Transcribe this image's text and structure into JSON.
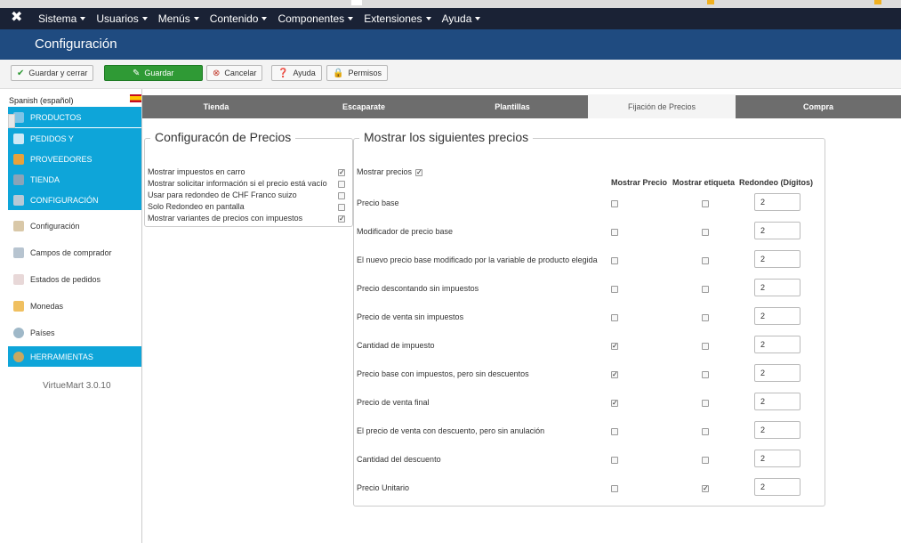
{
  "nav": {
    "items": [
      "Sistema",
      "Usuarios",
      "Menús",
      "Contenido",
      "Componentes",
      "Extensiones",
      "Ayuda"
    ]
  },
  "header": {
    "title": "Configuración"
  },
  "toolbar": {
    "save_close": "Guardar y cerrar",
    "save": "Guardar",
    "cancel": "Cancelar",
    "help": "Ayuda",
    "permissions": "Permisos"
  },
  "sidebar": {
    "language": "Spanish (español)",
    "items": [
      {
        "label": "PRODUCTOS",
        "icon": "box-icon",
        "style": "blue"
      },
      {
        "label": "PEDIDOS Y",
        "icon": "copy-icon",
        "style": "blue"
      },
      {
        "label": "PROVEEDORES",
        "icon": "wrench-icon",
        "style": "blue"
      },
      {
        "label": "TIENDA",
        "icon": "store-icon",
        "style": "blue"
      },
      {
        "label": "CONFIGURACIÓN",
        "icon": "tools-icon",
        "style": "blue"
      },
      {
        "label": "Configuración",
        "icon": "tools-icon",
        "style": "white"
      },
      {
        "label": "Campos de comprador",
        "icon": "form-icon",
        "style": "white"
      },
      {
        "label": "Estados de pedidos",
        "icon": "document-icon",
        "style": "white"
      },
      {
        "label": "Monedas",
        "icon": "coins-icon",
        "style": "white"
      },
      {
        "label": "Países",
        "icon": "globe-icon",
        "style": "white"
      },
      {
        "label": "HERRAMIENTAS",
        "icon": "gear-icon",
        "style": "blue"
      }
    ],
    "version": "VirtueMart 3.0.10"
  },
  "tabs": [
    "Tienda",
    "Escaparate",
    "Plantillas",
    "Fijación de Precios",
    "Compra"
  ],
  "active_tab": "Fijación de Precios",
  "left_panel": {
    "legend": "Configuracón de Precios",
    "rows": [
      {
        "label": "Mostrar impuestos en carro",
        "checked": true
      },
      {
        "label": "Mostrar solicitar información si el precio está vacío",
        "checked": false
      },
      {
        "label": "Usar para redondeo de CHF Franco suizo",
        "checked": false
      },
      {
        "label": "Solo Redondeo en pantalla",
        "checked": false
      },
      {
        "label": "Mostrar variantes de precios con impuestos",
        "checked": true
      }
    ]
  },
  "right_panel": {
    "legend": "Mostrar los siguientes precios",
    "show_prices_label": "Mostrar precios",
    "show_prices_checked": true,
    "col_show_price": "Mostrar Precio",
    "col_show_label": "Mostrar etiqueta",
    "col_rounding": "Redondeo (Dígitos)",
    "rows": [
      {
        "label": "Precio base",
        "show_price": false,
        "show_label": false,
        "rounding": "2"
      },
      {
        "label": "Modificador de precio base",
        "show_price": false,
        "show_label": false,
        "rounding": "2"
      },
      {
        "label": "El nuevo precio base modificado por la variable de producto elegida",
        "show_price": false,
        "show_label": false,
        "rounding": "2"
      },
      {
        "label": "Precio descontando sin impuestos",
        "show_price": false,
        "show_label": false,
        "rounding": "2"
      },
      {
        "label": "Precio de venta sin impuestos",
        "show_price": false,
        "show_label": false,
        "rounding": "2"
      },
      {
        "label": "Cantidad de impuesto",
        "show_price": true,
        "show_label": false,
        "rounding": "2"
      },
      {
        "label": "Precio base con impuestos, pero sin descuentos",
        "show_price": true,
        "show_label": false,
        "rounding": "2"
      },
      {
        "label": "Precio de venta final",
        "show_price": true,
        "show_label": false,
        "rounding": "2"
      },
      {
        "label": "El precio de venta con descuento, pero sin anulación",
        "show_price": false,
        "show_label": false,
        "rounding": "2"
      },
      {
        "label": "Cantidad del descuento",
        "show_price": false,
        "show_label": false,
        "rounding": "2"
      },
      {
        "label": "Precio Unitario",
        "show_price": false,
        "show_label": true,
        "rounding": "2"
      }
    ]
  }
}
